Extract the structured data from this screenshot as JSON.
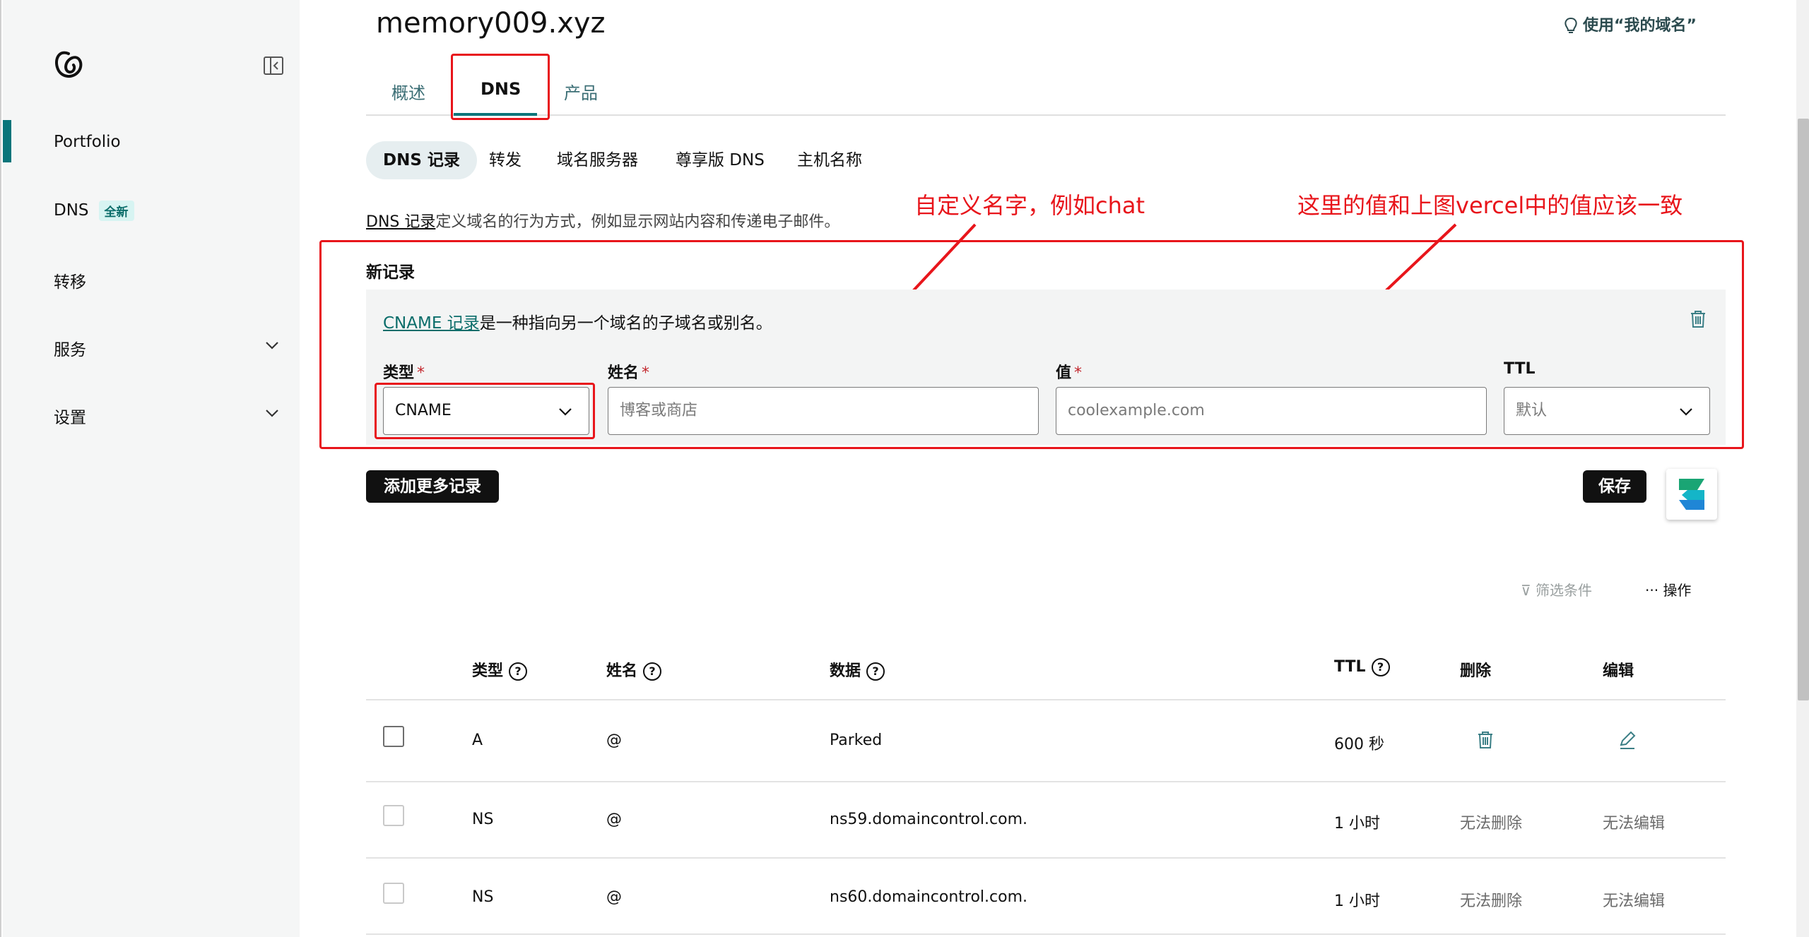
{
  "sidebar": {
    "items": [
      {
        "label": "Portfolio"
      },
      {
        "label": "DNS",
        "badge": "全新"
      },
      {
        "label": "转移"
      },
      {
        "label": "服务"
      },
      {
        "label": "设置"
      }
    ]
  },
  "header": {
    "domain": "memory009.xyz",
    "help_link": "使用“我的域名”"
  },
  "tabs": [
    {
      "label": "概述"
    },
    {
      "label": "DNS"
    },
    {
      "label": "产品"
    }
  ],
  "subtabs": [
    {
      "label": "DNS 记录"
    },
    {
      "label": "转发"
    },
    {
      "label": "域名服务器"
    },
    {
      "label": "尊享版 DNS"
    },
    {
      "label": "主机名称"
    }
  ],
  "description": {
    "link": "DNS 记录",
    "text": "定义域名的行为方式，例如显示网站内容和传递电子邮件。"
  },
  "annotations": {
    "name_hint": "自定义名字，例如chat",
    "value_hint": "这里的值和上图vercel中的值应该一致"
  },
  "new_record": {
    "title": "新记录",
    "cname_link": "CNAME 记录",
    "cname_text": "是一种指向另一个域名的子域名或别名。",
    "type_label": "类型",
    "type_value": "CNAME",
    "name_label": "姓名",
    "name_placeholder": "博客或商店",
    "value_label": "值",
    "value_placeholder": "coolexample.com",
    "ttl_label": "TTL",
    "ttl_value": "默认",
    "required_mark": "*"
  },
  "buttons": {
    "add_more": "添加更多记录",
    "save": "保存"
  },
  "toolbar": {
    "filter": "筛选条件",
    "actions": "操作"
  },
  "table": {
    "headers": {
      "type": "类型",
      "name": "姓名",
      "data": "数据",
      "ttl": "TTL",
      "delete": "删除",
      "edit": "编辑",
      "help_mark": "?"
    },
    "rows": [
      {
        "type": "A",
        "name": "@",
        "data": "Parked",
        "ttl": "600 秒",
        "delete": "",
        "edit": ""
      },
      {
        "type": "NS",
        "name": "@",
        "data": "ns59.domaincontrol.com.",
        "ttl": "1 小时",
        "delete": "无法删除",
        "edit": "无法编辑"
      },
      {
        "type": "NS",
        "name": "@",
        "data": "ns60.domaincontrol.com.",
        "ttl": "1 小时",
        "delete": "无法删除",
        "edit": "无法编辑"
      }
    ]
  },
  "colors": {
    "accent": "#09757a",
    "annotation_red": "#e8151b"
  }
}
